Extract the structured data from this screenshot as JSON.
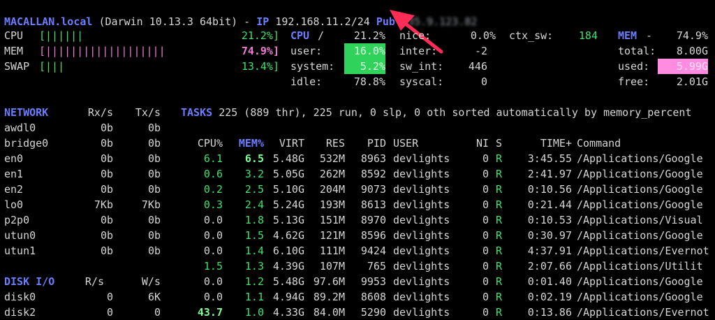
{
  "header": {
    "hostname": "MACALLAN.local",
    "os": "(Darwin 10.13.3 64bit) -",
    "ip_label": "IP",
    "ip": "192.168.11.2/24",
    "pub_label": "Pub",
    "pub_ip": "135.9.123.82"
  },
  "meters": {
    "cpu": {
      "label": "CPU",
      "bar": "[||||||",
      "value": "21.2%]"
    },
    "mem": {
      "label": "MEM",
      "bar": "[|||||||||||||||||||",
      "value": "74.9%]"
    },
    "swap": {
      "label": "SWAP",
      "bar": "[|||",
      "value": "13.4%]"
    }
  },
  "cpu_panel": {
    "title": "CPU",
    "slash": "/",
    "total": "21.2%",
    "user_label": "user:",
    "user": "16.0%",
    "system_label": "system:",
    "system": "5.2%",
    "idle_label": "idle:",
    "idle": "78.8%"
  },
  "cpu_panel2": {
    "nice_label": "nice:",
    "nice": "0.0%",
    "ctx_label": "ctx_sw:",
    "ctx": "184",
    "inter_label": "inter:",
    "inter": "-2",
    "swint_label": "sw_int:",
    "swint": "446",
    "syscal_label": "syscal:",
    "syscal": "0"
  },
  "mem_panel": {
    "title": "MEM",
    "dash": "-",
    "percent": "74.9%",
    "total_label": "total:",
    "total": "8.00G",
    "used_label": "used:",
    "used": "5.99G",
    "free_label": "free:",
    "free": "2.01G"
  },
  "network": {
    "title": "NETWORK",
    "rx_header": "Rx/s",
    "tx_header": "Tx/s",
    "rows": [
      {
        "iface": "awdl0",
        "rx": "0b",
        "tx": "0b"
      },
      {
        "iface": "bridge0",
        "rx": "0b",
        "tx": "0b"
      },
      {
        "iface": "en0",
        "rx": "0b",
        "tx": "0b"
      },
      {
        "iface": "en1",
        "rx": "0b",
        "tx": "0b"
      },
      {
        "iface": "en2",
        "rx": "0b",
        "tx": "0b"
      },
      {
        "iface": "lo0",
        "rx": "7Kb",
        "tx": "7Kb"
      },
      {
        "iface": "p2p0",
        "rx": "0b",
        "tx": "0b"
      },
      {
        "iface": "utun0",
        "rx": "0b",
        "tx": "0b"
      },
      {
        "iface": "utun1",
        "rx": "0b",
        "tx": "0b"
      }
    ]
  },
  "disk": {
    "title": "DISK I/O",
    "r_header": "R/s",
    "w_header": "W/s",
    "rows": [
      {
        "name": "disk0",
        "r": "0",
        "w": "6K"
      },
      {
        "name": "disk2",
        "r": "0",
        "w": "0"
      }
    ]
  },
  "tasks": {
    "title": "TASKS",
    "summary": "225 (889 thr), 225 run, 0 slp, 0 oth sorted automatically by memory_percent"
  },
  "proc_headers": {
    "cpu": "CPU%",
    "mem": "MEM%",
    "virt": "VIRT",
    "res": "RES",
    "pid": "PID",
    "user": "USER",
    "ni": "NI",
    "s": "S",
    "time": "TIME+",
    "cmd": "Command"
  },
  "processes": [
    {
      "cpu": "6.1",
      "mem": "6.5",
      "virt": "5.48G",
      "res": "532M",
      "pid": "8963",
      "user": "devlights",
      "ni": "0",
      "s": "R",
      "time": "3:45.55",
      "cmd": "/Applications/Google"
    },
    {
      "cpu": "0.6",
      "mem": "3.2",
      "virt": "5.05G",
      "res": "262M",
      "pid": "8592",
      "user": "devlights",
      "ni": "0",
      "s": "R",
      "time": "2:41.97",
      "cmd": "/Applications/Google"
    },
    {
      "cpu": "0.2",
      "mem": "2.5",
      "virt": "5.10G",
      "res": "204M",
      "pid": "9073",
      "user": "devlights",
      "ni": "0",
      "s": "R",
      "time": "0:10.56",
      "cmd": "/Applications/Google"
    },
    {
      "cpu": "0.3",
      "mem": "2.4",
      "virt": "5.24G",
      "res": "193M",
      "pid": "8613",
      "user": "devlights",
      "ni": "0",
      "s": "R",
      "time": "0:21.44",
      "cmd": "/Applications/Google"
    },
    {
      "cpu": "0.0",
      "mem": "1.8",
      "virt": "5.13G",
      "res": "151M",
      "pid": "8970",
      "user": "devlights",
      "ni": "0",
      "s": "R",
      "time": "0:10.53",
      "cmd": "/Applications/Visual"
    },
    {
      "cpu": "0.0",
      "mem": "1.5",
      "virt": "4.62G",
      "res": "121M",
      "pid": "8596",
      "user": "devlights",
      "ni": "0",
      "s": "R",
      "time": "0:30.97",
      "cmd": "/Applications/Google"
    },
    {
      "cpu": "0.0",
      "mem": "1.4",
      "virt": "6.10G",
      "res": "111M",
      "pid": "9424",
      "user": "devlights",
      "ni": "0",
      "s": "R",
      "time": "4:37.91",
      "cmd": "/Applications/Evernot"
    },
    {
      "cpu": "1.5",
      "mem": "1.3",
      "virt": "4.39G",
      "res": "107M",
      "pid": "765",
      "user": "devlights",
      "ni": "0",
      "s": "R",
      "time": "2:07.66",
      "cmd": "/Applications/Utilit"
    },
    {
      "cpu": "0.0",
      "mem": "1.2",
      "virt": "5.48G",
      "res": "97.6M",
      "pid": "9953",
      "user": "devlights",
      "ni": "0",
      "s": "R",
      "time": "0:01.40",
      "cmd": "/Applications/Google"
    },
    {
      "cpu": "0.0",
      "mem": "1.1",
      "virt": "4.94G",
      "res": "89.2M",
      "pid": "8608",
      "user": "devlights",
      "ni": "0",
      "s": "R",
      "time": "0:02.19",
      "cmd": "/Applications/Google"
    },
    {
      "cpu": "43.7",
      "mem": "1.0",
      "virt": "4.33G",
      "res": "84.0M",
      "pid": "5290",
      "user": "devlights",
      "ni": "0",
      "s": "R",
      "time": "0:13.86",
      "cmd": "/Applications/Evernot"
    }
  ],
  "colors": {
    "accent": "#6c7dff",
    "good": "#3de36a",
    "warn": "#f07ad6",
    "arrow": "#ff2d55"
  }
}
